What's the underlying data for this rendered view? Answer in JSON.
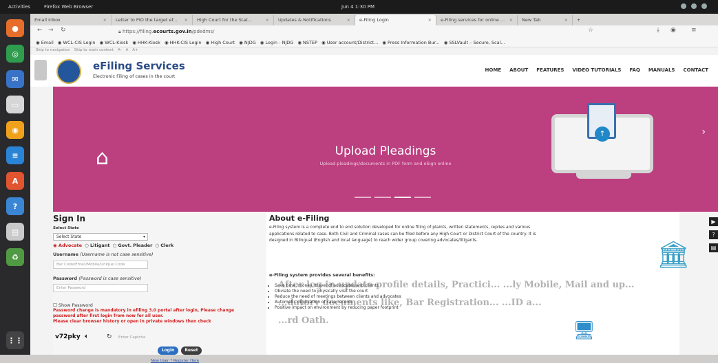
{
  "os": {
    "activities": "Activities",
    "app": "Firefox Web Browser",
    "clock": "Jun 4  1:30 PM"
  },
  "dock": [
    {
      "icon": "firefox-icon",
      "color": "#e76d2a",
      "glyph": "●"
    },
    {
      "icon": "chrome-icon",
      "color": "#2e9d4d",
      "glyph": "◎"
    },
    {
      "icon": "thunderbird-icon",
      "color": "#3873c8",
      "glyph": "✉"
    },
    {
      "icon": "files-icon",
      "color": "#d6d6d6",
      "glyph": "▭"
    },
    {
      "icon": "rhythmbox-icon",
      "color": "#f0a11b",
      "glyph": "◉"
    },
    {
      "icon": "writer-icon",
      "color": "#2a84d6",
      "glyph": "≡"
    },
    {
      "icon": "software-icon",
      "color": "#e0542f",
      "glyph": "A"
    },
    {
      "icon": "help-icon",
      "color": "#3a86d4",
      "glyph": "?"
    },
    {
      "icon": "viewer-icon",
      "color": "#c9c9c9",
      "glyph": "▤"
    },
    {
      "icon": "trash-icon",
      "color": "#4f9a43",
      "glyph": "♻"
    }
  ],
  "browser": {
    "tabs": [
      {
        "label": "Email inbox",
        "active": false
      },
      {
        "label": "Letter to PIO the target ef...",
        "active": false
      },
      {
        "label": "High Court for the Stat...",
        "active": false
      },
      {
        "label": "Updates & Notifications",
        "active": false
      },
      {
        "label": "e-Filing Login",
        "active": true
      },
      {
        "label": "e-Filing services for online ...",
        "active": false
      },
      {
        "label": "New Tab",
        "active": false
      }
    ],
    "url_prefix": "https://filing.",
    "url_domain": "ecourts.gov.in",
    "url_path": "/pdedms/",
    "bookmarks": [
      "Email",
      "WCL-CIS Login",
      "WCL-Kiosk",
      "HHK-Kiosk",
      "HHK-CIS Login",
      "High Court",
      "NJDG",
      "Login - NJDG",
      "NSTEP",
      "User account/District...",
      "Press Information Bur...",
      "SSLVault – Secure, Scal..."
    ],
    "skip_links": [
      "Skip to navigation",
      "Skip to main content",
      "A-",
      "A",
      "A+"
    ]
  },
  "site": {
    "title": "eFiling Services",
    "subtitle": "Electronic Filing of cases in the court",
    "menu": [
      "HOME",
      "ABOUT",
      "FEATURES",
      "VIDEO TUTORIALS",
      "FAQ",
      "MANUALS",
      "CONTACT"
    ]
  },
  "banner": {
    "title": "Upload Pleadings",
    "subtitle": "Upload pleadings/documents in PDF form and eSign online",
    "background": "#bc3f80",
    "slides": 4,
    "active_slide": 2
  },
  "signin": {
    "heading": "Sign In",
    "state_label": "Select State",
    "state_value": "Select State",
    "roles": [
      "Advocate",
      "Litigant",
      "Govt. Pleader",
      "Clerk"
    ],
    "selected_role": "Advocate",
    "username_label": "Username",
    "username_hint": "(Username is not case sensitive)",
    "username_placeholder": "Bar Code/Email/Mobile/Unique Code",
    "password_label": "Password",
    "password_hint": "(Password is case sensitive)",
    "password_placeholder": "Enter Password",
    "show_password": "Show Password",
    "warning1": "Password change is mandatory in efiling 3.0 portal after login, Please change",
    "warning2": "password after first login from now for all user.",
    "warning3": "Please clear browser history or open in private windows then check",
    "captcha": "v72pky",
    "captcha_placeholder": "Enter Captcha",
    "login_label": "Login",
    "reset_label": "Reset",
    "register_label": "New User ? Register Here"
  },
  "about": {
    "heading": "About e-Filing",
    "paragraph": "e-Filing system is a complete end to end solution developed for online filing of plaints, written statements, replies and various applications related to case. Both Civil and Criminal cases can be filed before any High Court or District Court of the country. It is designed in Bilingual (English and local language) to reach wider group covering advocates/litigants.",
    "benefits_heading": "e-Filing system provides several benefits:",
    "benefits": [
      "Save time, money, travel of advocates and clients",
      "Obviate the need to physically visit the court",
      "Reduce the need of meetings between clients and advocates",
      "Automatic digitization of case records",
      "Positive impact on environment by reducing paper footprint"
    ]
  },
  "overlay_text": [
    "After log in update profile details, Practici... ...ly Mobile, Mail and up...",
    "...datory documents like, Bar Registration... ...ID a...",
    "...rd Oath."
  ]
}
